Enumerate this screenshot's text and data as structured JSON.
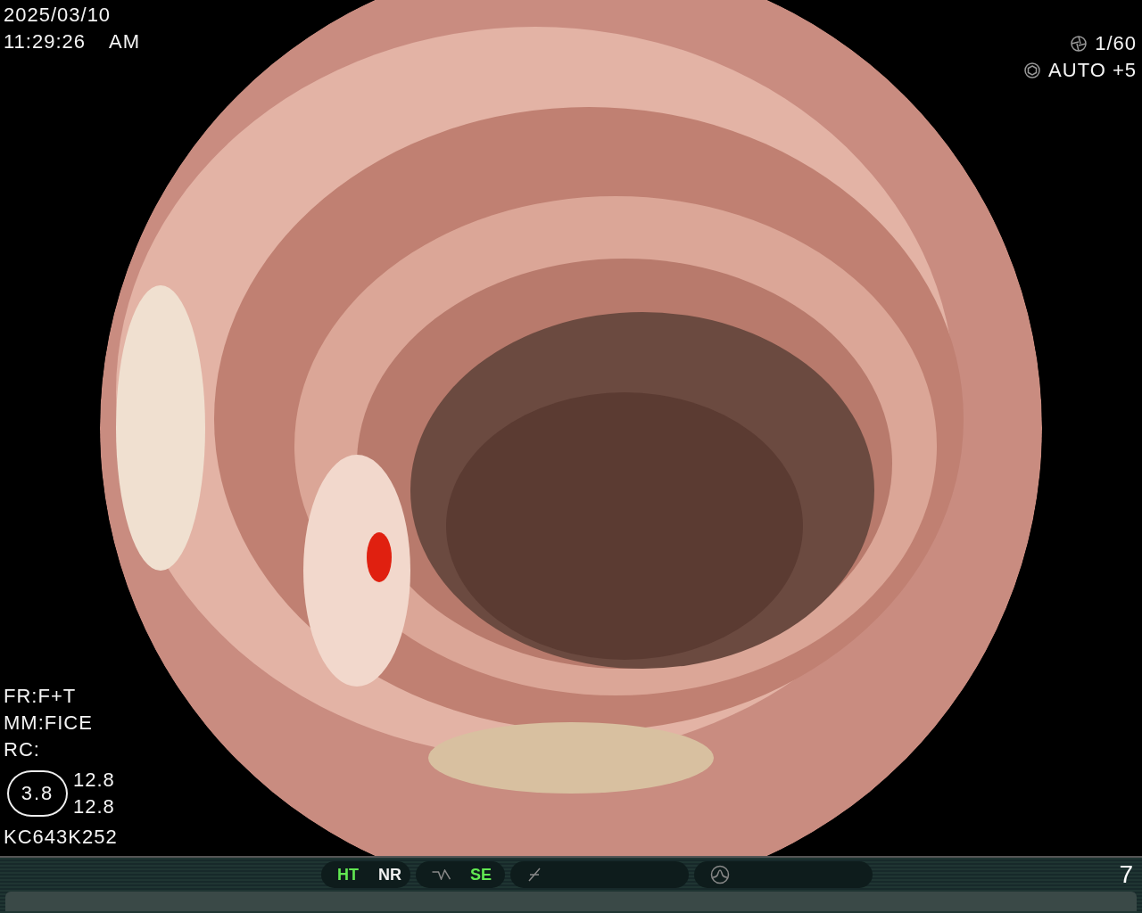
{
  "clock": {
    "date": "2025/03/10",
    "time": "11:29:26",
    "period": "AM"
  },
  "exposure": {
    "shutter": "1/60",
    "iris": "AUTO +5"
  },
  "settings": [
    {
      "text": "FR:F+T"
    },
    {
      "text": "MM:FICE"
    },
    {
      "text": "RC:"
    }
  ],
  "zoom_badge": {
    "value": "3.8",
    "readings": [
      "12.8",
      "12.8"
    ]
  },
  "scope_id": "KC643K252",
  "status_bar": {
    "groups": [
      {
        "kind": "text",
        "items": [
          {
            "label": "HT",
            "on": true
          },
          {
            "label": "NR",
            "on": false
          }
        ]
      },
      {
        "kind": "curve",
        "items": [
          {
            "label": "SE",
            "on": true
          }
        ]
      },
      {
        "kind": "slash"
      },
      {
        "kind": "peak"
      }
    ],
    "counter": "7"
  }
}
